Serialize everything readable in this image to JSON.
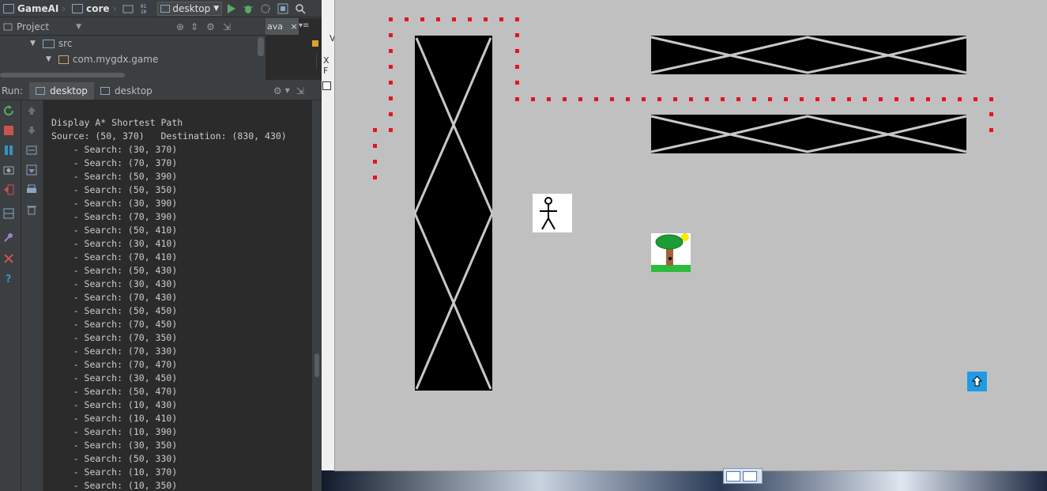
{
  "toolbar": {
    "project": "GameAI",
    "module": "core",
    "run_config": "desktop"
  },
  "project_panel": {
    "title": "Project",
    "tree": [
      {
        "label": "src"
      },
      {
        "label": "com.mygdx.game"
      }
    ]
  },
  "editor_peek": {
    "tab": "ava",
    "letter1": "V",
    "letter2": "X F"
  },
  "run_panel": {
    "label": "Run:",
    "tabs": [
      "desktop",
      "desktop"
    ]
  },
  "console": {
    "lines": [
      "Display A* Shortest Path",
      "Source: (50, 370)   Destination: (830, 430)",
      "    - Search: (30, 370)",
      "    - Search: (70, 370)",
      "    - Search: (50, 390)",
      "    - Search: (50, 350)",
      "    - Search: (30, 390)",
      "    - Search: (70, 390)",
      "    - Search: (50, 410)",
      "    - Search: (30, 410)",
      "    - Search: (70, 410)",
      "    - Search: (50, 430)",
      "    - Search: (30, 430)",
      "    - Search: (70, 430)",
      "    - Search: (50, 450)",
      "    - Search: (70, 450)",
      "    - Search: (70, 350)",
      "    - Search: (70, 330)",
      "    - Search: (70, 470)",
      "    - Search: (30, 450)",
      "    - Search: (50, 470)",
      "    - Search: (10, 430)",
      "    - Search: (10, 410)",
      "    - Search: (10, 390)",
      "    - Search: (30, 350)",
      "    - Search: (50, 330)",
      "    - Search: (10, 370)",
      "    - Search: (10, 350)"
    ]
  },
  "game": {
    "path_color": "#e8141a",
    "obstacle_color": "#000000",
    "background": "#c0c0c0"
  }
}
